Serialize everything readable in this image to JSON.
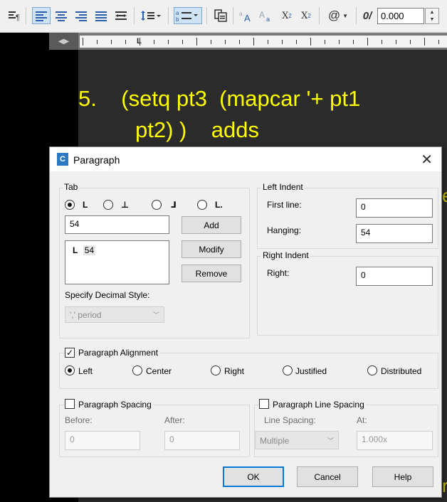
{
  "toolbar": {
    "icons": [
      "paragraph-icon",
      "align-left-icon",
      "align-center-icon",
      "align-right-icon",
      "justify-icon",
      "distribute-icon",
      "line-spacing-icon",
      "numbering-icon",
      "insert-field-icon",
      "uppercase-icon",
      "lowercase-icon",
      "superscript-icon",
      "subscript-icon",
      "symbol-icon",
      "oblique-icon"
    ],
    "superscript_label": "X",
    "superscript_mark": "2",
    "subscript_label": "X",
    "subscript_mark": "2",
    "symbol_label": "@",
    "oblique_label": "0/",
    "oblique_value": "0.000"
  },
  "editor": {
    "line1": "5.    (setq pt3  (mapcar '+ pt1",
    "line2": "pt2) )    adds"
  },
  "dialog": {
    "title": "Paragraph",
    "tab": {
      "label": "Tab",
      "input_value": "54",
      "list_item": "54",
      "add": "Add",
      "modify": "Modify",
      "remove": "Remove",
      "decimal_label": "Specify Decimal Style:",
      "decimal_value": "',' period"
    },
    "left_indent": {
      "label": "Left Indent",
      "first_line_label": "First line:",
      "first_line_value": "0",
      "hanging_label": "Hanging:",
      "hanging_value": "54"
    },
    "right_indent": {
      "label": "Right Indent",
      "right_label": "Right:",
      "right_value": "0"
    },
    "alignment": {
      "label": "Paragraph Alignment",
      "options": [
        "Left",
        "Center",
        "Right",
        "Justified",
        "Distributed"
      ],
      "selected": "Left"
    },
    "spacing": {
      "label": "Paragraph Spacing",
      "before_label": "Before:",
      "before_value": "0",
      "after_label": "After:",
      "after_value": "0"
    },
    "line_spacing": {
      "label": "Paragraph Line Spacing",
      "spacing_label": "Line Spacing:",
      "spacing_value": "Multiple",
      "at_label": "At:",
      "at_value": "1.000x"
    },
    "buttons": {
      "ok": "OK",
      "cancel": "Cancel",
      "help": "Help"
    }
  }
}
